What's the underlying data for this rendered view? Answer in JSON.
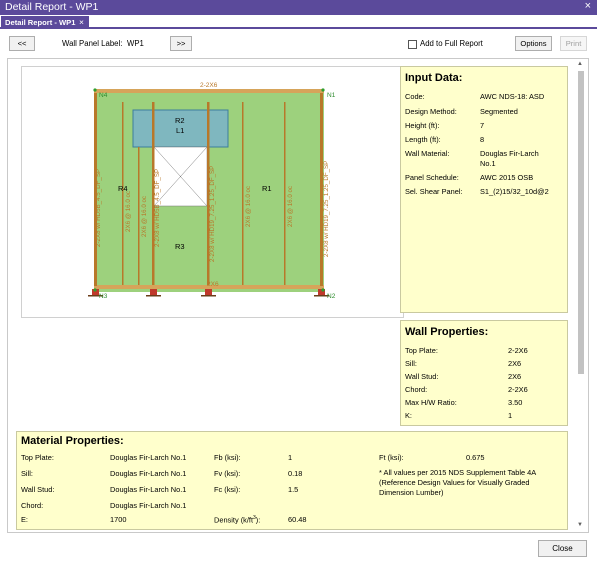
{
  "window": {
    "title": "Detail Report - WP1",
    "close_glyph": "×"
  },
  "tab": {
    "label": "Detail Report - WP1",
    "close_glyph": "×"
  },
  "toolbar": {
    "prev_label": "<<",
    "wall_panel_label": "Wall Panel Label:",
    "wall_panel_value": "WP1",
    "next_label": ">>",
    "add_full_report_label": "Add to Full Report",
    "add_full_report_checked": false,
    "options_label": "Options",
    "print_label": "Print"
  },
  "diagram": {
    "node_labels": {
      "n1": "N1",
      "n2": "N2",
      "n3": "N3",
      "n4": "N4"
    },
    "top_plate_label": "2-2X6",
    "sill_label": "2X6",
    "region_labels": {
      "r1": "R1",
      "r2": "R2",
      "r3": "R3",
      "r4": "R4",
      "l1": "L1"
    },
    "vertical_labels": [
      "2-2X8 w/ HD5B_4.5_DF_SP",
      "2X6 @ 16.0 oc",
      "2X6 @ 16.0 oc",
      "2-2X8 w/ HD5B_4.5_DF_SP",
      "2-2X8 w/ HD19_7.25_1.25_DF_SP",
      "2X6 @ 16.0 oc",
      "2X6 @ 16.0 oc",
      "2-2X8 w/ HD19_7.25_1.25_DF_SP"
    ],
    "colors": {
      "wall_fill": "#9dd17d",
      "header_fill": "#7fb7bf",
      "plate": "#d6a45a",
      "stud": "#b8782a",
      "anchor": "#c0392b",
      "node": "#2e9e2e"
    }
  },
  "input_data": {
    "title": "Input Data:",
    "rows": [
      {
        "key": "Code:",
        "value": "AWC NDS-18: ASD"
      },
      {
        "key": "Design Method:",
        "value": "Segmented"
      },
      {
        "key": "Height (ft):",
        "value": "7"
      },
      {
        "key": "Length (ft):",
        "value": "8"
      },
      {
        "key": "Wall Material:",
        "value": "Douglas Fir-Larch",
        "value2": "No.1"
      },
      {
        "key": "Panel Schedule:",
        "value": "AWC 2015 OSB"
      },
      {
        "key": "Sel. Shear Panel:",
        "value": "S1_(2)15/32_10d@2"
      }
    ]
  },
  "wall_properties": {
    "title": "Wall Properties:",
    "rows": [
      {
        "key": "Top Plate:",
        "value": "2-2X6"
      },
      {
        "key": "Sill:",
        "value": "2X6"
      },
      {
        "key": "Wall Stud:",
        "value": "2X6"
      },
      {
        "key": "Chord:",
        "value": "2-2X6"
      },
      {
        "key": "Max H/W Ratio:",
        "value": "3.50"
      },
      {
        "key": "K:",
        "value": "1"
      }
    ]
  },
  "material_properties": {
    "title": "Material Properties:",
    "rows": [
      {
        "key": "Top Plate:",
        "value": "Douglas Fir-Larch No.1"
      },
      {
        "key": "Sill:",
        "value": "Douglas Fir-Larch No.1"
      },
      {
        "key": "Wall Stud:",
        "value": "Douglas Fir-Larch No.1"
      },
      {
        "key": "Chord:",
        "value": "Douglas Fir-Larch No.1"
      },
      {
        "key": "E:",
        "value": "1700"
      }
    ],
    "props": [
      {
        "key": "Fb (ksi):",
        "value": "1"
      },
      {
        "key": "Fv (ksi):",
        "value": "0.18"
      },
      {
        "key": "Fc (ksi):",
        "value": "1.5"
      }
    ],
    "density_key_prefix": "Density (k/ft",
    "density_key_sup": "3",
    "density_key_suffix": "):",
    "density_value": "60.48",
    "ft_key": "Ft (ksi):",
    "ft_value": "0.675",
    "note": [
      "* All values per 2015 NDS Supplement Table 4A",
      "(Reference Design Values for Visually Graded",
      "Dimension Lumber)"
    ]
  },
  "scrollbar": {
    "up_glyph": "▲",
    "down_glyph": "▼"
  },
  "footer": {
    "close_label": "Close"
  }
}
